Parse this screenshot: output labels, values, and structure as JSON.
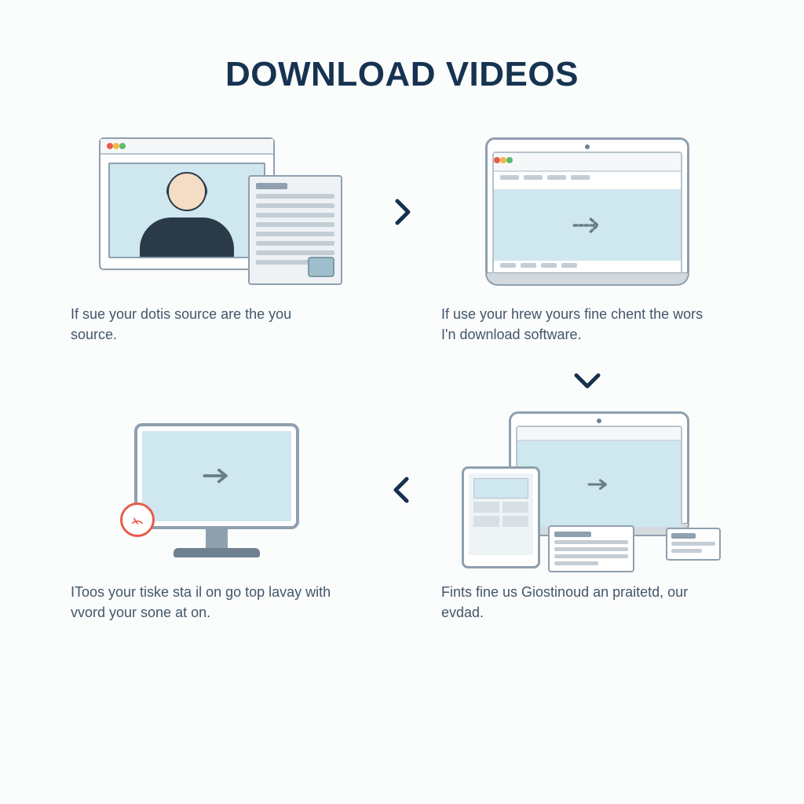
{
  "title": "DOWNLOAD VIDEOS",
  "steps": {
    "s1": {
      "caption": "If sue your dotis source are the you source."
    },
    "s2": {
      "caption": "If use your hrew yours fine chent the wors I'n download software."
    },
    "s3": {
      "caption": "IToos your tiske sta il on go top lavay with vvord your sone at on."
    },
    "s4": {
      "caption": "Fints fine us Giostinoud an praitetd, our evdad."
    }
  },
  "icons": {
    "arrow_right": "chevron-right-icon",
    "arrow_down": "chevron-down-icon",
    "arrow_left": "chevron-left-icon",
    "download_badge": "download-gauge-icon"
  },
  "colors": {
    "title": "#163351",
    "text": "#42566a",
    "outline": "#8fa0ae",
    "screen": "#cfe7ef",
    "accent_red": "#e85c4a"
  }
}
